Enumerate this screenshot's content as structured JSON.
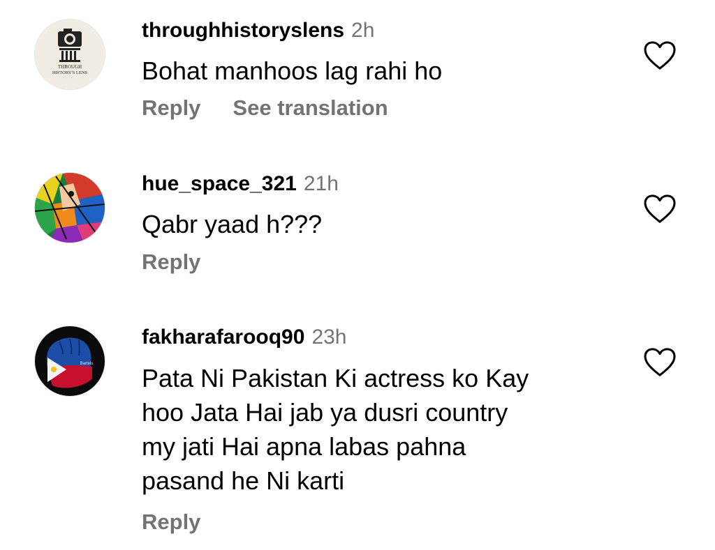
{
  "comments": [
    {
      "username": "throughhistoryslens",
      "time": "2h",
      "lines": [
        "Bohat manhoos lag rahi ho"
      ],
      "reply_label": "Reply",
      "translate_label": "See translation",
      "avatar": {
        "icon": "camera-column-logo-icon",
        "text_line1": "THROUGH",
        "text_line2": "HISTORY'S LENS"
      },
      "like_icon": "heart-outline-icon"
    },
    {
      "username": "hue_space_321",
      "time": "21h",
      "lines": [
        "Qabr yaad h???"
      ],
      "reply_label": "Reply",
      "avatar": {
        "icon": "abstract-cubist-face-icon"
      },
      "like_icon": "heart-outline-icon"
    },
    {
      "username": "fakharafarooq90",
      "time": "23h",
      "lines": [
        "Pata Ni Pakistan Ki actress ko Kay",
        "hoo Jata Hai jab ya dusri country",
        "my jati Hai apna labas pahna",
        "pasand he Ni karti"
      ],
      "reply_label": "Reply",
      "avatar": {
        "icon": "philippine-flag-fist-icon",
        "text": "Bartels"
      },
      "like_icon": "heart-outline-icon"
    }
  ],
  "colors": {
    "text": "#000000",
    "secondary": "#737373",
    "background": "#ffffff"
  }
}
